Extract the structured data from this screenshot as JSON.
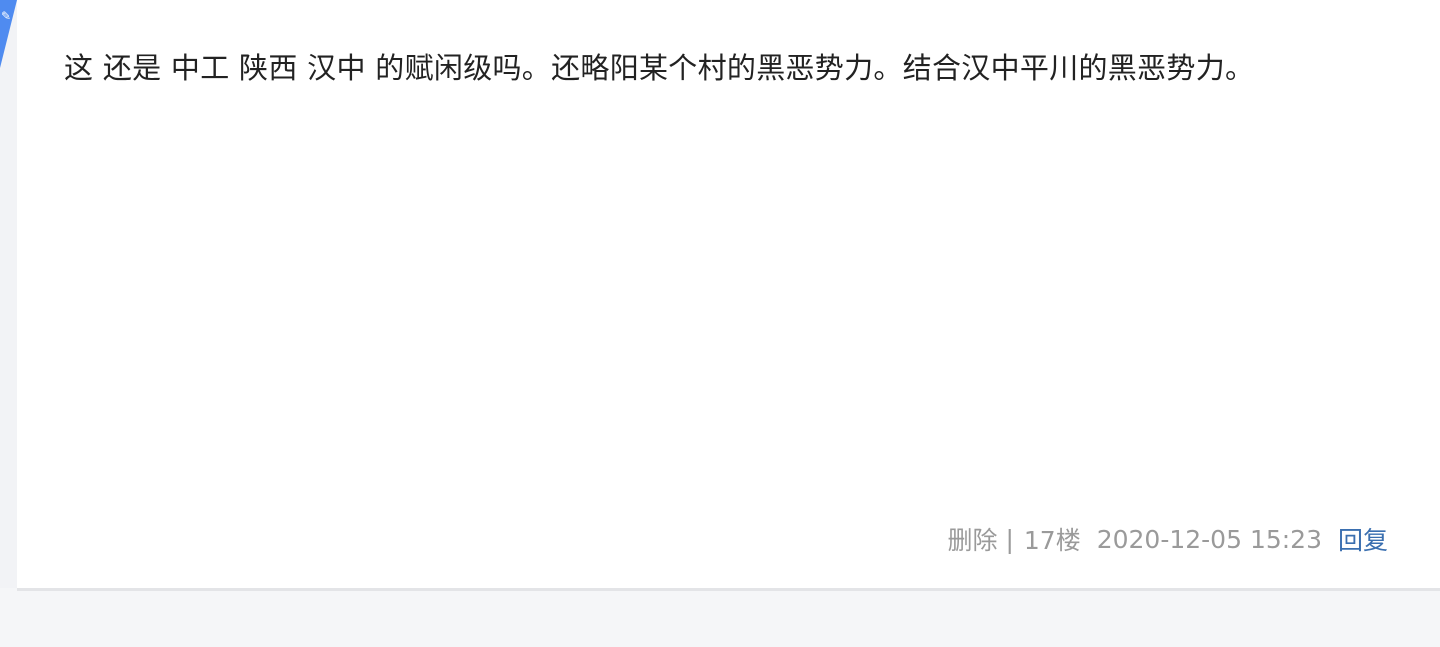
{
  "post": {
    "content": "这 还是 中工 陕西 汉中 的赋闲级吗。还略阳某个村的黑恶势力。结合汉中平川的黑恶势力。",
    "badge_icon": "pin-icon",
    "accent_color": "#4f8bf0"
  },
  "meta": {
    "delete_label": "删除",
    "separator": "|",
    "floor": "17楼",
    "timestamp": "2020-12-05 15:23",
    "reply_label": "回复",
    "reply_color": "#3a6fb0"
  }
}
